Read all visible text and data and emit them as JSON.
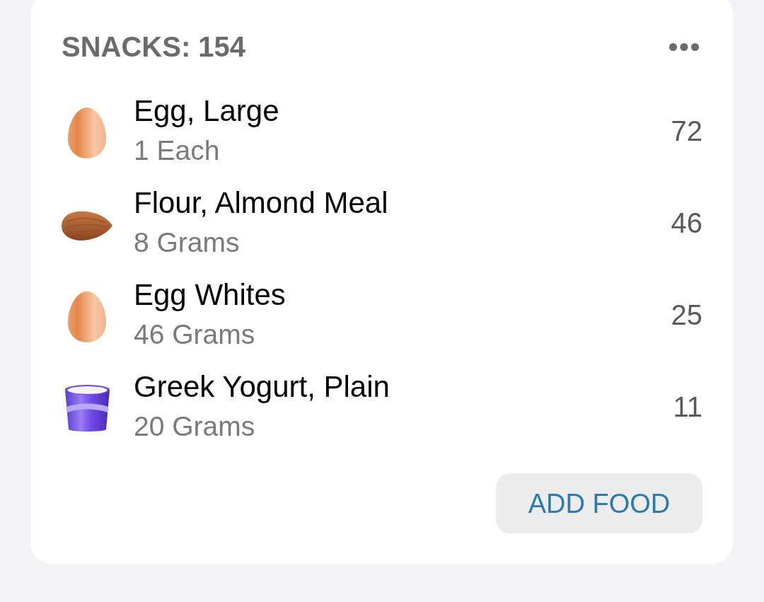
{
  "meal": {
    "title": "SNACKS: 154",
    "items": [
      {
        "kind": "egg",
        "name": "Egg, Large",
        "serving": "1 Each",
        "calories": "72"
      },
      {
        "kind": "almond",
        "name": "Flour, Almond Meal",
        "serving": "8 Grams",
        "calories": "46"
      },
      {
        "kind": "egg",
        "name": "Egg Whites",
        "serving": "46 Grams",
        "calories": "25"
      },
      {
        "kind": "yogurt",
        "name": "Greek Yogurt, Plain",
        "serving": "20 Grams",
        "calories": "11"
      }
    ],
    "add_button": "ADD FOOD"
  }
}
